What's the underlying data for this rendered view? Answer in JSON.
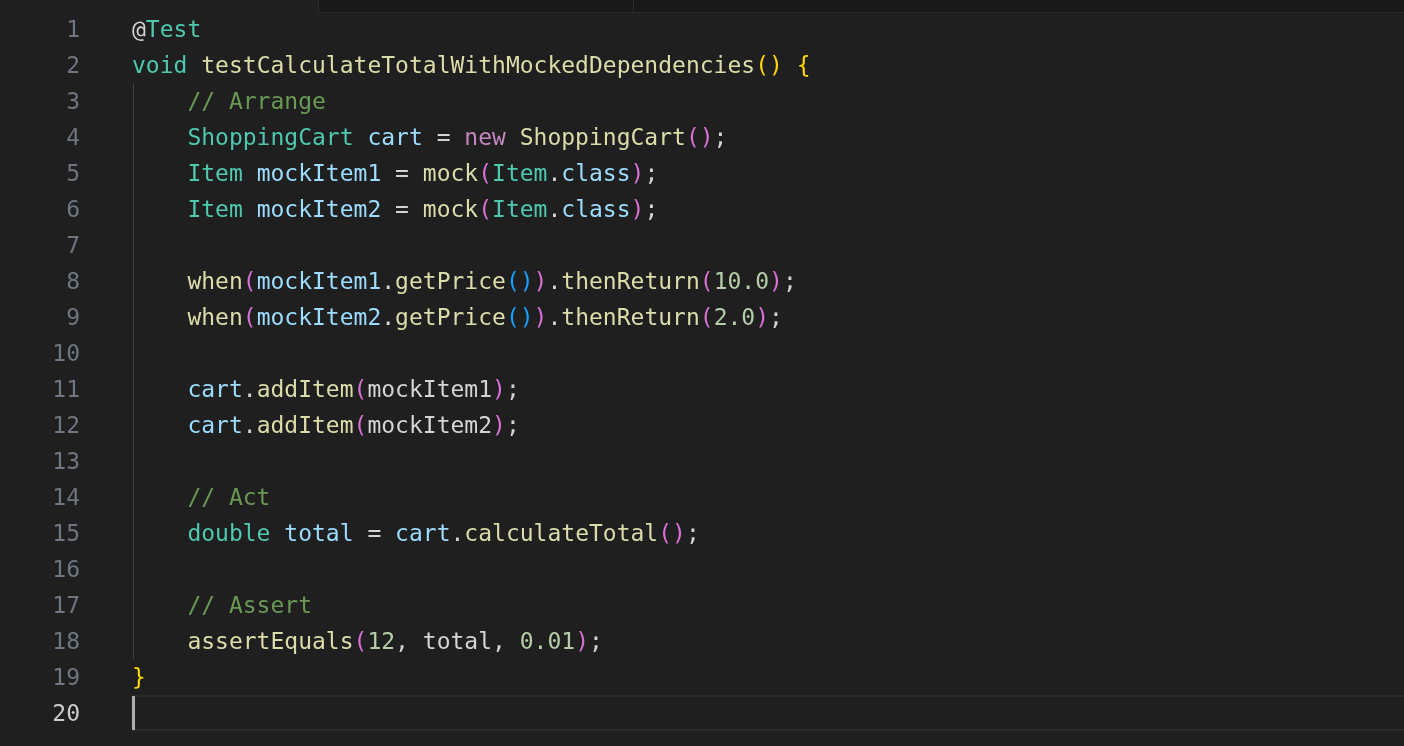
{
  "editor": {
    "lines": [
      {
        "number": "1",
        "current": false,
        "indented": false,
        "tokens": [
          {
            "text": "@",
            "kind": "plain"
          },
          {
            "text": "Test",
            "kind": "type"
          }
        ]
      },
      {
        "number": "2",
        "current": false,
        "indented": false,
        "tokens": [
          {
            "text": "void ",
            "kind": "type"
          },
          {
            "text": "testCalculateTotalWithMockedDependencies",
            "kind": "function"
          },
          {
            "text": "() {",
            "kind": "brace"
          }
        ]
      },
      {
        "number": "3",
        "current": false,
        "indented": true,
        "tokens": [
          {
            "text": "// Arrange",
            "kind": "comment"
          }
        ]
      },
      {
        "number": "4",
        "current": false,
        "indented": true,
        "tokens": [
          {
            "text": "ShoppingCart ",
            "kind": "type"
          },
          {
            "text": "cart",
            "kind": "variable"
          },
          {
            "text": " = ",
            "kind": "plain"
          },
          {
            "text": "new ",
            "kind": "keyword"
          },
          {
            "text": "ShoppingCart",
            "kind": "function"
          },
          {
            "text": "()",
            "kind": "paren"
          },
          {
            "text": ";",
            "kind": "plain"
          }
        ]
      },
      {
        "number": "5",
        "current": false,
        "indented": true,
        "tokens": [
          {
            "text": "Item ",
            "kind": "type"
          },
          {
            "text": "mockItem1",
            "kind": "variable"
          },
          {
            "text": " = ",
            "kind": "plain"
          },
          {
            "text": "mock",
            "kind": "function"
          },
          {
            "text": "(",
            "kind": "paren"
          },
          {
            "text": "Item",
            "kind": "type"
          },
          {
            "text": ".",
            "kind": "plain"
          },
          {
            "text": "class",
            "kind": "variable"
          },
          {
            "text": ")",
            "kind": "paren"
          },
          {
            "text": ";",
            "kind": "plain"
          }
        ]
      },
      {
        "number": "6",
        "current": false,
        "indented": true,
        "tokens": [
          {
            "text": "Item ",
            "kind": "type"
          },
          {
            "text": "mockItem2",
            "kind": "variable"
          },
          {
            "text": " = ",
            "kind": "plain"
          },
          {
            "text": "mock",
            "kind": "function"
          },
          {
            "text": "(",
            "kind": "paren"
          },
          {
            "text": "Item",
            "kind": "type"
          },
          {
            "text": ".",
            "kind": "plain"
          },
          {
            "text": "class",
            "kind": "variable"
          },
          {
            "text": ")",
            "kind": "paren"
          },
          {
            "text": ";",
            "kind": "plain"
          }
        ]
      },
      {
        "number": "7",
        "current": false,
        "indented": true
      },
      {
        "number": "8",
        "current": false,
        "indented": true,
        "tokens": [
          {
            "text": "when",
            "kind": "function"
          },
          {
            "text": "(",
            "kind": "paren"
          },
          {
            "text": "mockItem1",
            "kind": "variable"
          },
          {
            "text": ".",
            "kind": "plain"
          },
          {
            "text": "getPrice",
            "kind": "function"
          },
          {
            "text": "()",
            "kind": "inner"
          },
          {
            "text": ")",
            "kind": "paren"
          },
          {
            "text": ".",
            "kind": "plain"
          },
          {
            "text": "thenReturn",
            "kind": "function"
          },
          {
            "text": "(",
            "kind": "paren"
          },
          {
            "text": "10.0",
            "kind": "number"
          },
          {
            "text": ")",
            "kind": "paren"
          },
          {
            "text": ";",
            "kind": "plain"
          }
        ]
      },
      {
        "number": "9",
        "current": false,
        "indented": true,
        "tokens": [
          {
            "text": "when",
            "kind": "function"
          },
          {
            "text": "(",
            "kind": "paren"
          },
          {
            "text": "mockItem2",
            "kind": "variable"
          },
          {
            "text": ".",
            "kind": "plain"
          },
          {
            "text": "getPrice",
            "kind": "function"
          },
          {
            "text": "()",
            "kind": "inner"
          },
          {
            "text": ")",
            "kind": "paren"
          },
          {
            "text": ".",
            "kind": "plain"
          },
          {
            "text": "thenReturn",
            "kind": "function"
          },
          {
            "text": "(",
            "kind": "paren"
          },
          {
            "text": "2.0",
            "kind": "number"
          },
          {
            "text": ")",
            "kind": "paren"
          },
          {
            "text": ";",
            "kind": "plain"
          }
        ]
      },
      {
        "number": "10",
        "current": false,
        "indented": true
      },
      {
        "number": "11",
        "current": false,
        "indented": true,
        "tokens": [
          {
            "text": "cart",
            "kind": "variable"
          },
          {
            "text": ".",
            "kind": "plain"
          },
          {
            "text": "addItem",
            "kind": "function"
          },
          {
            "text": "(",
            "kind": "paren"
          },
          {
            "text": "mockItem1",
            "kind": "plain"
          },
          {
            "text": ")",
            "kind": "paren"
          },
          {
            "text": ";",
            "kind": "plain"
          }
        ]
      },
      {
        "number": "12",
        "current": false,
        "indented": true,
        "tokens": [
          {
            "text": "cart",
            "kind": "variable"
          },
          {
            "text": ".",
            "kind": "plain"
          },
          {
            "text": "addItem",
            "kind": "function"
          },
          {
            "text": "(",
            "kind": "paren"
          },
          {
            "text": "mockItem2",
            "kind": "plain"
          },
          {
            "text": ")",
            "kind": "paren"
          },
          {
            "text": ";",
            "kind": "plain"
          }
        ]
      },
      {
        "number": "13",
        "current": false,
        "indented": true
      },
      {
        "number": "14",
        "current": false,
        "indented": true,
        "tokens": [
          {
            "text": "// Act",
            "kind": "comment"
          }
        ]
      },
      {
        "number": "15",
        "current": false,
        "indented": true,
        "tokens": [
          {
            "text": "double ",
            "kind": "type"
          },
          {
            "text": "total",
            "kind": "variable"
          },
          {
            "text": " = ",
            "kind": "plain"
          },
          {
            "text": "cart",
            "kind": "variable"
          },
          {
            "text": ".",
            "kind": "plain"
          },
          {
            "text": "calculateTotal",
            "kind": "function"
          },
          {
            "text": "()",
            "kind": "paren"
          },
          {
            "text": ";",
            "kind": "plain"
          }
        ]
      },
      {
        "number": "16",
        "current": false,
        "indented": true
      },
      {
        "number": "17",
        "current": false,
        "indented": true,
        "tokens": [
          {
            "text": "// Assert",
            "kind": "comment"
          }
        ]
      },
      {
        "number": "18",
        "current": false,
        "indented": true,
        "tokens": [
          {
            "text": "assertEquals",
            "kind": "function"
          },
          {
            "text": "(",
            "kind": "paren"
          },
          {
            "text": "12",
            "kind": "number"
          },
          {
            "text": ", total, ",
            "kind": "plain"
          },
          {
            "text": "0.01",
            "kind": "number"
          },
          {
            "text": ")",
            "kind": "paren"
          },
          {
            "text": ";",
            "kind": "plain"
          }
        ]
      },
      {
        "number": "19",
        "current": false,
        "indented": false,
        "tokens": [
          {
            "text": "}",
            "kind": "brace"
          }
        ]
      },
      {
        "number": "20",
        "current": true,
        "indented": false
      }
    ]
  }
}
